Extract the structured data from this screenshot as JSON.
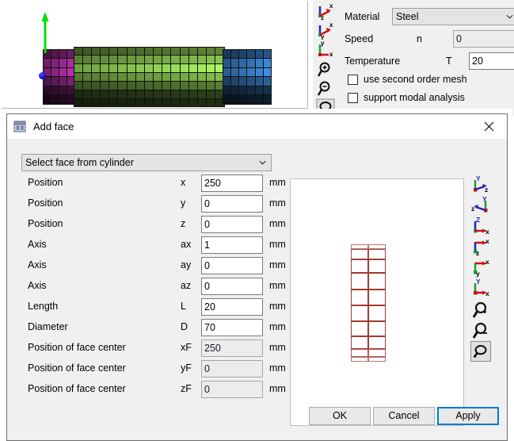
{
  "background_app": {
    "viewport": {
      "name": "3d-mesh-viewport",
      "axis_arrow": "y-axis-arrow",
      "axis_color": "#00dd00",
      "origin_marker": "origin-point",
      "origin_color": "#1212c8",
      "segments": [
        {
          "name": "shaft-segment-magenta",
          "color": "#aa25a0",
          "cols": 4,
          "rows": 6
        },
        {
          "name": "shaft-segment-green",
          "color": "#76d13c",
          "cols": 17,
          "rows": 7
        },
        {
          "name": "shaft-segment-blue",
          "color": "#1d6fd6",
          "cols": 6,
          "rows": 6
        }
      ]
    },
    "toolbar_icons": [
      "view-zx-icon",
      "view-zx-alt-icon",
      "view-yx-icon",
      "zoom-in-icon",
      "zoom-out-icon",
      "zoom-fit-icon"
    ],
    "properties": {
      "material_label": "Material",
      "material_value": "Steel",
      "speed_label": "Speed",
      "speed_symbol": "n",
      "speed_value": "0",
      "temperature_label": "Temperature",
      "temperature_symbol": "T",
      "temperature_value": "20",
      "checkboxes": [
        {
          "label": "use second order mesh",
          "checked": false
        },
        {
          "label": "support modal analysis",
          "checked": false
        },
        {
          "label": "",
          "checked": false
        }
      ]
    }
  },
  "dialog": {
    "title": "Add face",
    "icon": "app-window-icon",
    "close_icon": "close-icon",
    "selector": {
      "value": "Select face from cylinder",
      "chevron": "chevron-down-icon"
    },
    "fields": [
      {
        "label": "Position",
        "symbol": "x",
        "value": "250",
        "unit": "mm",
        "disabled": false,
        "name": "position-x"
      },
      {
        "label": "Position",
        "symbol": "y",
        "value": "0",
        "unit": "mm",
        "disabled": false,
        "name": "position-y"
      },
      {
        "label": "Position",
        "symbol": "z",
        "value": "0",
        "unit": "mm",
        "disabled": false,
        "name": "position-z"
      },
      {
        "label": "Axis",
        "symbol": "ax",
        "value": "1",
        "unit": "mm",
        "disabled": false,
        "name": "axis-ax"
      },
      {
        "label": "Axis",
        "symbol": "ay",
        "value": "0",
        "unit": "mm",
        "disabled": false,
        "name": "axis-ay"
      },
      {
        "label": "Axis",
        "symbol": "az",
        "value": "0",
        "unit": "mm",
        "disabled": false,
        "name": "axis-az"
      },
      {
        "label": "Length",
        "symbol": "L",
        "value": "20",
        "unit": "mm",
        "disabled": false,
        "name": "length"
      },
      {
        "label": "Diameter",
        "symbol": "D",
        "value": "70",
        "unit": "mm",
        "disabled": false,
        "name": "diameter"
      },
      {
        "label": "Position of face center",
        "symbol": "xF",
        "value": "250",
        "unit": "mm",
        "disabled": true,
        "name": "face-center-x"
      },
      {
        "label": "Position of face center",
        "symbol": "yF",
        "value": "0",
        "unit": "mm",
        "disabled": true,
        "name": "face-center-y"
      },
      {
        "label": "Position of face center",
        "symbol": "zF",
        "value": "0",
        "unit": "mm",
        "disabled": true,
        "name": "face-center-z"
      }
    ],
    "preview": {
      "name": "face-preview",
      "mesh_color": "#9e3a33",
      "mesh_cols": 2,
      "mesh_rows": 10,
      "background": "#ffffff"
    },
    "toolbar_icons": [
      "view-yz-icon",
      "view-zy-icon",
      "view-zx-icon",
      "view-zx-alt-icon",
      "view-yx-icon",
      "view-yx-alt-icon",
      "zoom-in-icon",
      "zoom-out-icon",
      "zoom-fit-icon"
    ],
    "buttons": {
      "ok": "OK",
      "cancel": "Cancel",
      "apply": "Apply",
      "focused": "apply"
    }
  }
}
